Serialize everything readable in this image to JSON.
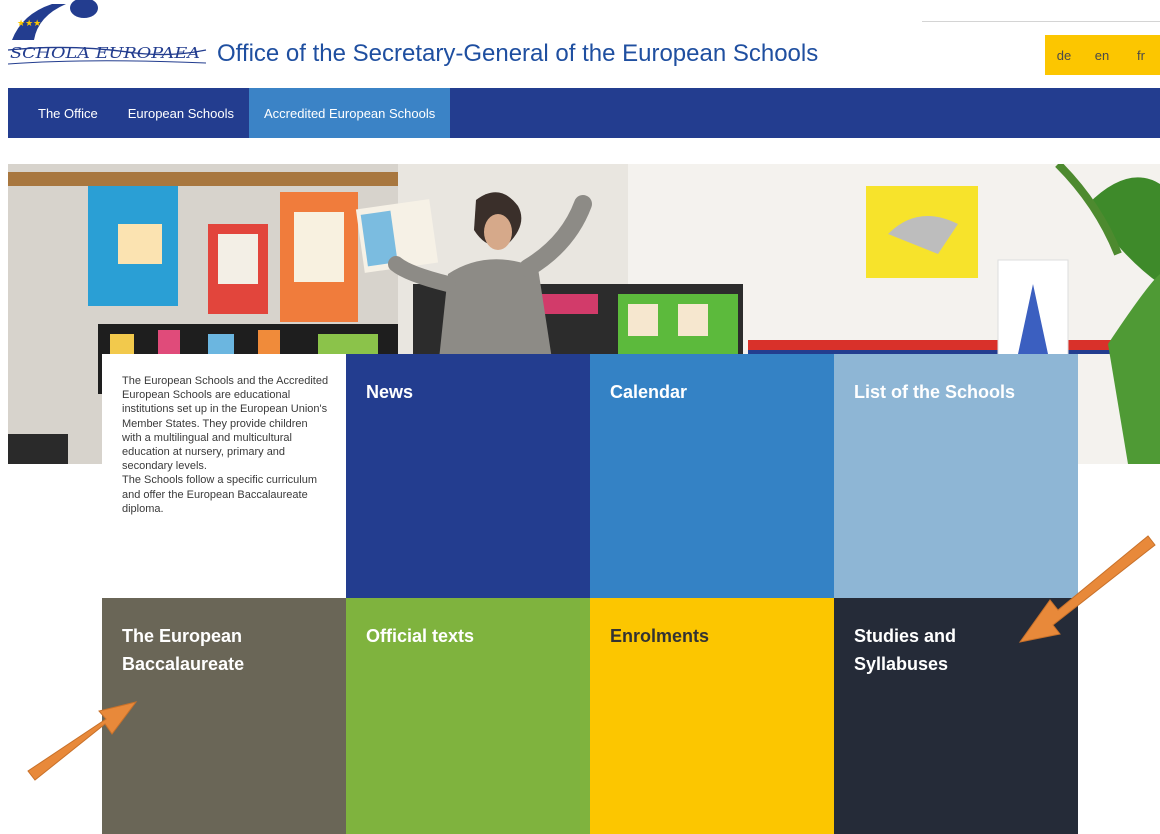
{
  "header": {
    "title": "Office of the Secretary-General of the European Schools",
    "logo_text": "SCHOLA EUROPAEA"
  },
  "languages": [
    "de",
    "en",
    "fr"
  ],
  "nav": {
    "items": [
      "The Office",
      "European Schools",
      "Accredited European Schools"
    ],
    "active": "Accredited European Schools"
  },
  "intro": {
    "paragraph1": "The European Schools and the Accredited European Schools are educational institutions set up in the European Union's Member States. They provide children with a multilingual and multicultural education at nursery, primary and secondary levels.",
    "paragraph2": "The Schools follow a specific curriculum and offer the European Baccalaureate diploma."
  },
  "tiles": [
    {
      "label": "News",
      "color": "#233d8f"
    },
    {
      "label": "Calendar",
      "color": "#3482c5"
    },
    {
      "label": "List of the Schools",
      "color": "#8eb6d5"
    },
    {
      "label": "The European\nBaccalaureate",
      "color": "#6a6657"
    },
    {
      "label": "Official texts",
      "color": "#7fb33e"
    },
    {
      "label": "Enrolments",
      "color": "#fcc600",
      "text_color": "#333333"
    },
    {
      "label": "Studies and\nSyllabuses",
      "color": "#252b38"
    }
  ],
  "colors": {
    "nav_bg": "#233d8f",
    "nav_active": "#3b83c6",
    "lang_bg": "#fcc600",
    "title_blue": "#1f4fa0",
    "annotation_arrow": "#e8893a"
  }
}
